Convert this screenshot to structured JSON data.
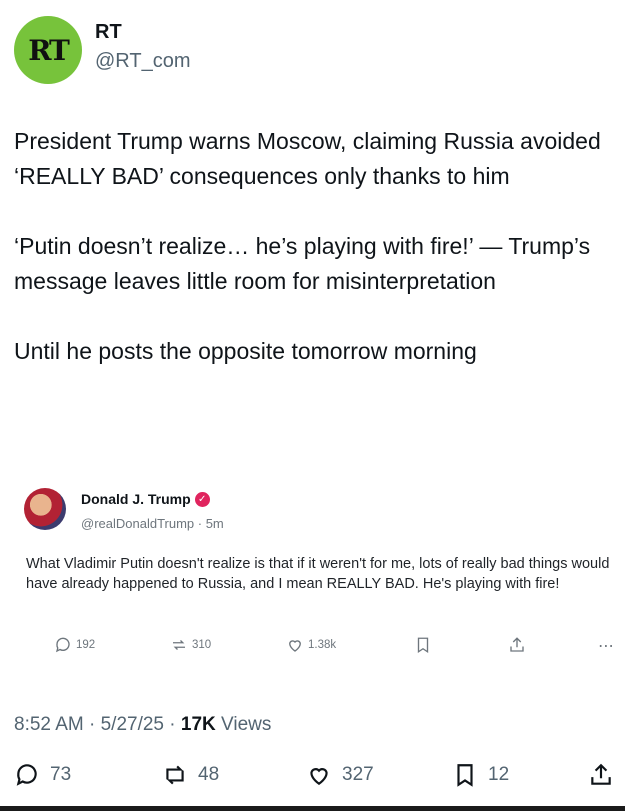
{
  "account": {
    "avatar_text": "RT",
    "display_name": "RT",
    "handle": "@RT_com"
  },
  "tweet": {
    "paragraphs": [
      "President Trump warns Moscow, claiming Russia avoided ‘REALLY BAD’ consequences only thanks to him",
      "‘Putin doesn’t realize… he’s playing with fire!’ — Trump’s message leaves little room for misinterpretation",
      "Until he posts the opposite tomorrow morning"
    ]
  },
  "quote": {
    "display_name": "Donald J. Trump",
    "handle_time": "@realDonaldTrump · 5m",
    "text": "What Vladimir Putin doesn't realize is that if it weren't for me, lots of really bad things would have already happened to Russia, and I mean REALLY BAD. He's playing with fire!",
    "replies": "192",
    "reposts": "310",
    "likes": "1.38k",
    "verified_color": "#e0245e"
  },
  "meta": {
    "time_date": "8:52 AM · 5/27/25 · ",
    "views_count": "17K",
    "views_label": " Views"
  },
  "actions": {
    "replies": "73",
    "reposts": "48",
    "likes": "327",
    "bookmarks": "12"
  },
  "colors": {
    "avatar_bg": "#77c33b",
    "text": "#0f1419",
    "secondary": "#536471"
  }
}
